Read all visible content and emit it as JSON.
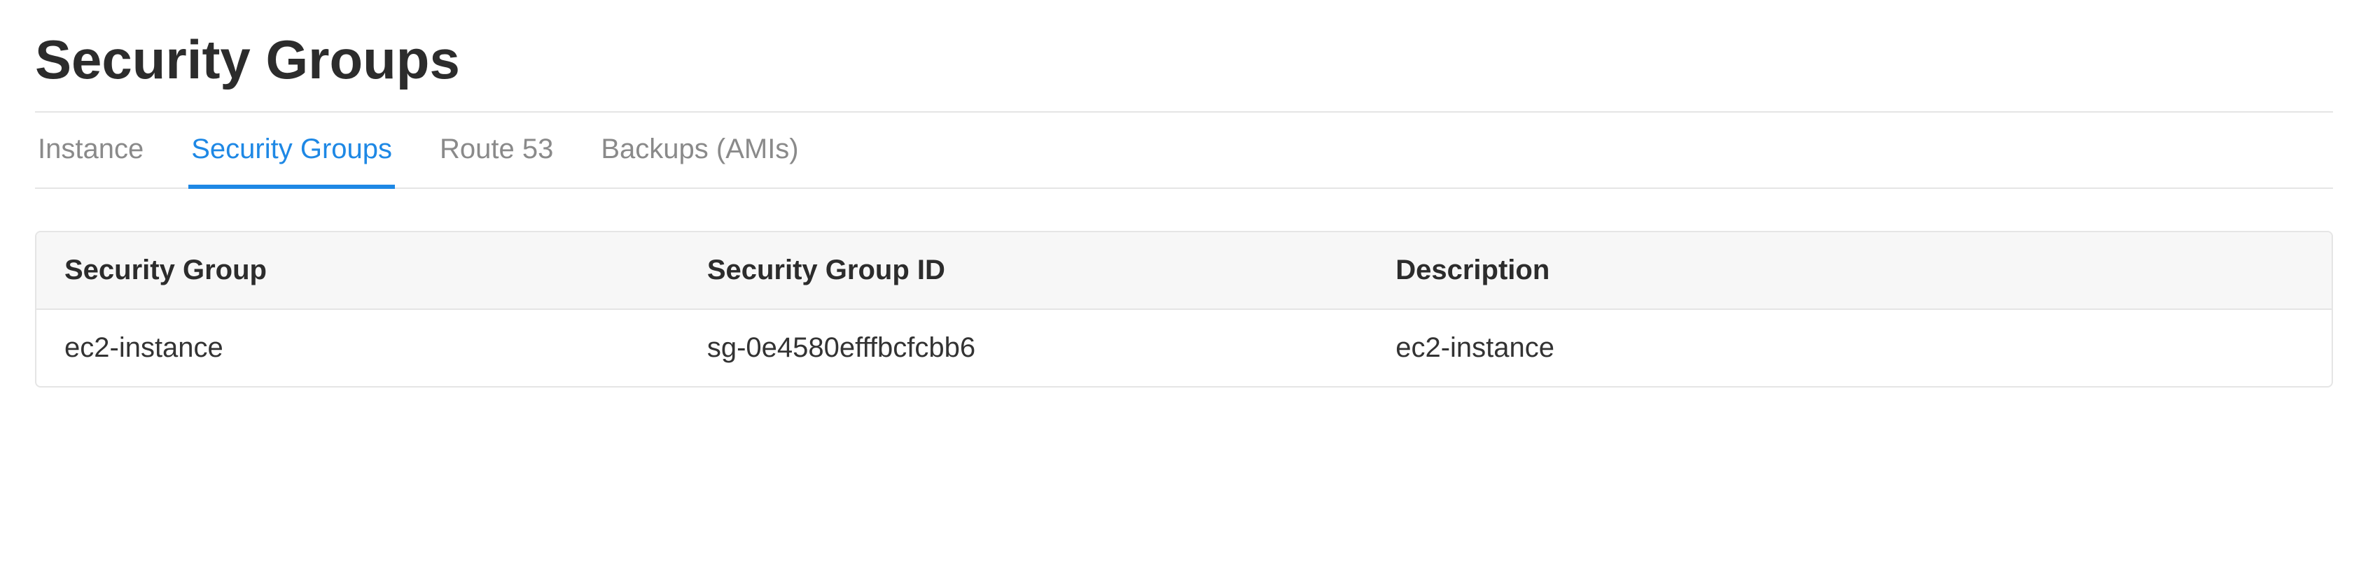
{
  "page": {
    "title": "Security Groups"
  },
  "tabs": [
    {
      "label": "Instance",
      "active": false
    },
    {
      "label": "Security Groups",
      "active": true
    },
    {
      "label": "Route 53",
      "active": false
    },
    {
      "label": "Backups (AMIs)",
      "active": false
    }
  ],
  "table": {
    "headers": [
      "Security Group",
      "Security Group ID",
      "Description"
    ],
    "rows": [
      {
        "name": "ec2-instance",
        "id": "sg-0e4580efffbcfcbb6",
        "description": "ec2-instance"
      }
    ]
  }
}
